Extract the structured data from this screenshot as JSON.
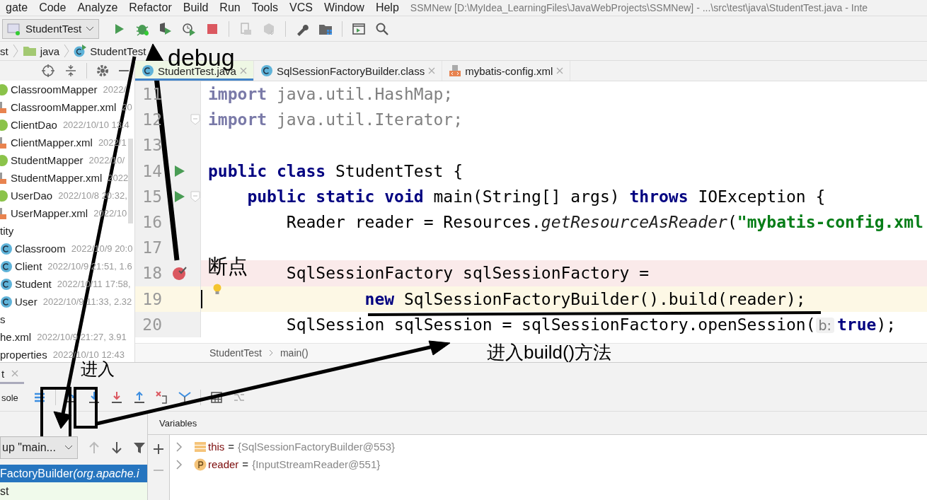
{
  "menu": [
    "gate",
    "Code",
    "Analyze",
    "Refactor",
    "Build",
    "Run",
    "Tools",
    "VCS",
    "Window",
    "Help"
  ],
  "window": {
    "title": "SSMNew [D:\\MyIdea_LearningFiles\\JavaWebProjects\\SSMNew] - ...\\src\\test\\java\\StudentTest.java - Inte"
  },
  "toolbar": {
    "run_config": "StudentTest"
  },
  "navbar": [
    {
      "label": "st",
      "kind": "plain"
    },
    {
      "label": "java",
      "kind": "folder"
    },
    {
      "label": "StudentTest",
      "kind": "class"
    }
  ],
  "project_tree": [
    {
      "name": "ClassroomMapper",
      "meta": "2022/",
      "kind": "interface"
    },
    {
      "name": "ClassroomMapper.xml",
      "meta": "20",
      "kind": "xml"
    },
    {
      "name": "ClientDao",
      "meta": "2022/10/10 13:4",
      "kind": "interface"
    },
    {
      "name": "ClientMapper.xml",
      "meta": "2022/1",
      "kind": "xml"
    },
    {
      "name": "StudentMapper",
      "meta": "2022/10/",
      "kind": "interface"
    },
    {
      "name": "StudentMapper.xml",
      "meta": "2022",
      "kind": "xml"
    },
    {
      "name": "UserDao",
      "meta": "2022/10/8 20:32,",
      "kind": "interface"
    },
    {
      "name": "UserMapper.xml",
      "meta": "2022/10",
      "kind": "xml"
    },
    {
      "name": "tity",
      "kind": "package"
    },
    {
      "name": "Classroom",
      "meta": "2022/10/9 20:0",
      "kind": "class"
    },
    {
      "name": "Client",
      "meta": "2022/10/9 21:51, 1.6",
      "kind": "class"
    },
    {
      "name": "Student",
      "meta": "2022/10/11 17:58,",
      "kind": "class"
    },
    {
      "name": "User",
      "meta": "2022/10/9 11:33, 2.32",
      "kind": "class"
    },
    {
      "name": "s",
      "kind": "package"
    },
    {
      "name": "he.xml",
      "meta": "2022/10/9 21:27, 3.91",
      "kind": "package"
    },
    {
      "name": "properties",
      "meta": "2022/10/10 12:43",
      "kind": "package"
    }
  ],
  "editor_tabs": [
    {
      "label": "StudentTest.java",
      "kind": "class",
      "selected": true
    },
    {
      "label": "SqlSessionFactoryBuilder.class",
      "kind": "class",
      "selected": false
    },
    {
      "label": "mybatis-config.xml",
      "kind": "xml",
      "selected": false
    }
  ],
  "code_lines": [
    {
      "number": "11",
      "tokens": [
        {
          "kind": "kw2",
          "text": "import"
        },
        {
          "kind": "dim",
          "text": " java.util.HashMap;"
        }
      ]
    },
    {
      "number": "12",
      "fold": true,
      "tokens": [
        {
          "kind": "kw2",
          "text": "import"
        },
        {
          "kind": "dim",
          "text": " java.util.Iterator;"
        }
      ]
    },
    {
      "number": "13"
    },
    {
      "number": "14",
      "run": true,
      "tokens": [
        {
          "kind": "kw",
          "text": "public class"
        },
        {
          "kind": "plain",
          "text": " StudentTest {"
        }
      ]
    },
    {
      "number": "15",
      "run": true,
      "fold": true,
      "tokens": [
        {
          "kind": "kw",
          "text": "    public static void"
        },
        {
          "kind": "plain",
          "text": " main(String[] args) "
        },
        {
          "kind": "kw",
          "text": "throws"
        },
        {
          "kind": "plain",
          "text": " IOException {"
        }
      ]
    },
    {
      "number": "16",
      "tokens": [
        {
          "kind": "plain",
          "text": "        Reader reader = Resources."
        },
        {
          "kind": "italic",
          "text": "getResourceAsReader"
        },
        {
          "kind": "plain",
          "text": "("
        },
        {
          "kind": "string",
          "text": "\"mybatis-config.xml"
        }
      ]
    },
    {
      "number": "17"
    },
    {
      "number": "18",
      "breakpoint": true,
      "tokens": [
        {
          "kind": "plain",
          "text": "        SqlSessionFactory sqlSessionFactory ="
        }
      ]
    },
    {
      "number": "19",
      "current": true,
      "tokens": [
        {
          "kind": "kw",
          "text": "                new"
        },
        {
          "kind": "plain",
          "text": " SqlSessionFactoryBuilder().build(reader);"
        }
      ]
    },
    {
      "number": "20",
      "tokens": [
        {
          "kind": "plain",
          "text": "        SqlSession sqlSession = sqlSessionFactory.openSession("
        },
        {
          "kind": "hint",
          "text": "b:"
        },
        {
          "kind": "kw",
          "text": "true"
        },
        {
          "kind": "plain",
          "text": ");"
        }
      ]
    }
  ],
  "editor_breadcrumb": [
    "StudentTest",
    "main()"
  ],
  "debug": {
    "tab": "t",
    "console_label": "sole",
    "thread": "up \"main...",
    "frames": [
      {
        "method": "FactoryBuilder",
        "location": "(org.apache.i",
        "selected": true
      },
      {
        "method": "st",
        "selected": false
      }
    ],
    "variables_title": "Variables",
    "variables": [
      {
        "name": "this",
        "operator": "=",
        "value": "{SqlSessionFactoryBuilder@553}",
        "kind": "object"
      },
      {
        "name": "reader",
        "operator": "=",
        "value": "{InputStreamReader@551}",
        "kind": "param"
      }
    ]
  },
  "annotations": [
    "debug",
    "断点",
    "进入",
    "进入build()方法"
  ]
}
